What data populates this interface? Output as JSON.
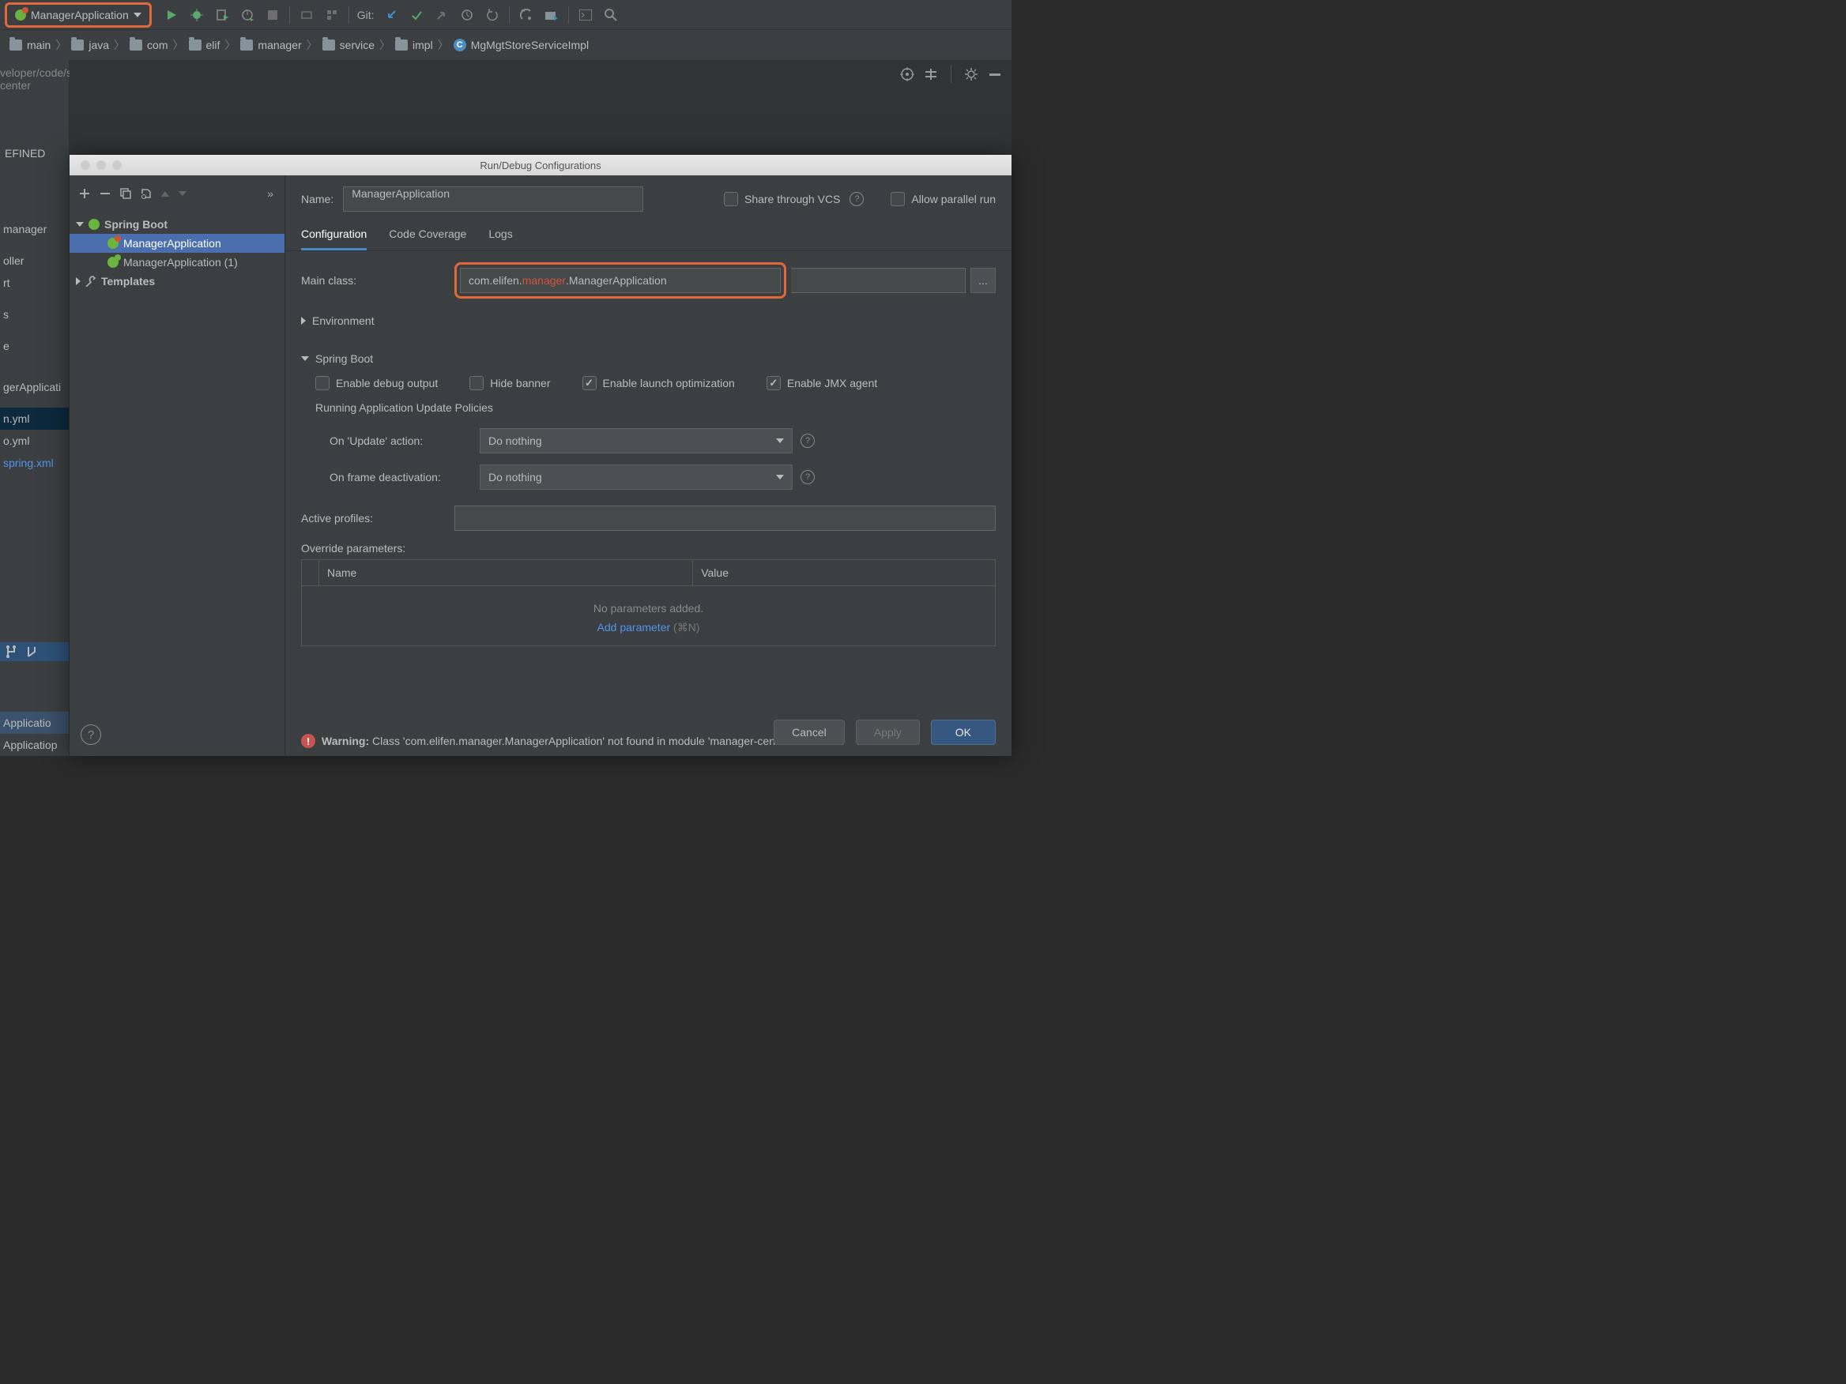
{
  "toolbar": {
    "run_config_name": "ManagerApplication",
    "git_label": "Git:"
  },
  "breadcrumb": [
    {
      "icon": "folder",
      "label": "main"
    },
    {
      "icon": "folder",
      "label": "java"
    },
    {
      "icon": "folder",
      "label": "com"
    },
    {
      "icon": "folder",
      "label": "elif"
    },
    {
      "icon": "folder",
      "label": "manager"
    },
    {
      "icon": "folder",
      "label": "service"
    },
    {
      "icon": "folder",
      "label": "impl"
    },
    {
      "icon": "class",
      "label": "MgMgtStoreServiceImpl"
    }
  ],
  "project_path_fragment": "veloper/code/sshy/manager-center",
  "project_section_label": "EFINED",
  "left_items": [
    {
      "label": "manager",
      "sel": false
    },
    {
      "label": "",
      "sel": false
    },
    {
      "label": "oller",
      "sel": false
    },
    {
      "label": "rt",
      "sel": false
    },
    {
      "label": "",
      "sel": false
    },
    {
      "label": "s",
      "sel": false
    },
    {
      "label": "",
      "sel": false
    },
    {
      "label": "e",
      "sel": false
    },
    {
      "label": "",
      "sel": false
    },
    {
      "label": "",
      "sel": false
    },
    {
      "label": "gerApplicati",
      "sel": false
    },
    {
      "label": "",
      "sel": false
    },
    {
      "label": "n.yml",
      "sel": "sel2"
    },
    {
      "label": "o.yml",
      "sel": false
    },
    {
      "label": "spring.xml",
      "sel": false,
      "blue": true
    }
  ],
  "run_panel_items": [
    {
      "label": "Applicatio"
    },
    {
      "label": "Applicatiop"
    }
  ],
  "dialog": {
    "title": "Run/Debug Configurations",
    "left_tools": {},
    "tree": {
      "spring_boot_label": "Spring Boot",
      "templates_label": "Templates",
      "items": [
        {
          "label": "ManagerApplication",
          "err": true,
          "sel": true
        },
        {
          "label": "ManagerApplication (1)",
          "err": false,
          "sel": false
        }
      ]
    },
    "name_label": "Name:",
    "name_value": "ManagerApplication",
    "share_label": "Share through VCS",
    "parallel_label": "Allow parallel run",
    "tabs": [
      {
        "label": "Configuration",
        "active": true
      },
      {
        "label": "Code Coverage",
        "active": false
      },
      {
        "label": "Logs",
        "active": false
      }
    ],
    "main_class_label": "Main class:",
    "main_class_value": {
      "pre": "com.elifen.",
      "err": "manager",
      "post": ".ManagerApplication"
    },
    "environment_label": "Environment",
    "spring_boot_section": "Spring Boot",
    "checkboxes": {
      "debug": "Enable debug output",
      "hide_banner": "Hide banner",
      "launch_opt": "Enable launch optimization",
      "jmx": "Enable JMX agent"
    },
    "policies_label": "Running Application Update Policies",
    "on_update_label": "On 'Update' action:",
    "on_update_value": "Do nothing",
    "on_frame_label": "On frame deactivation:",
    "on_frame_value": "Do nothing",
    "active_profiles_label": "Active profiles:",
    "override_params_label": "Override parameters:",
    "params_header_name": "Name",
    "params_header_value": "Value",
    "no_params": "No parameters added.",
    "add_param_label": "Add parameter",
    "add_param_shortcut": "(⌘N)",
    "warning_bold": "Warning:",
    "warning_text": " Class 'com.elifen.manager.ManagerApplication' not found in module 'manager-center'",
    "buttons": {
      "cancel": "Cancel",
      "apply": "Apply",
      "ok": "OK"
    }
  }
}
